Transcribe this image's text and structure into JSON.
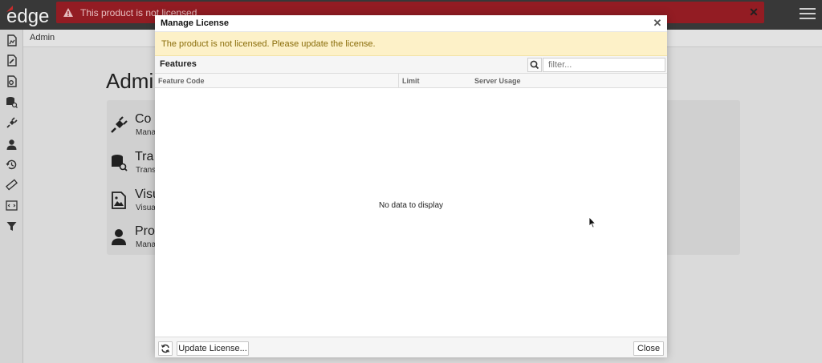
{
  "app": {
    "logo_text": "edge",
    "banner_text": "This product is not licensed",
    "breadcrumb": "Admin",
    "page_title": "Admin"
  },
  "sidebar": {
    "items": [
      {
        "icon": "report-icon"
      },
      {
        "icon": "edit-doc-icon"
      },
      {
        "icon": "doc-settings-icon"
      },
      {
        "icon": "database-search-icon"
      },
      {
        "icon": "plug-icon"
      },
      {
        "icon": "user-icon"
      },
      {
        "icon": "history-icon"
      },
      {
        "icon": "ruler-icon"
      },
      {
        "icon": "code-icon"
      },
      {
        "icon": "filter-icon"
      }
    ]
  },
  "cards": [
    {
      "title": "Co",
      "sub": "Mana",
      "icon": "plug-icon"
    },
    {
      "title": "Tra",
      "sub": "Trans",
      "icon": "database-search-icon"
    },
    {
      "title": "Visu",
      "sub": "Visua",
      "icon": "image-icon"
    },
    {
      "title": "Prov",
      "sub": "Mana",
      "icon": "user-icon"
    }
  ],
  "modal": {
    "title": "Manage License",
    "alert": "The product is not licensed. Please update the license.",
    "features_label": "Features",
    "filter_placeholder": "filter...",
    "columns": [
      "Feature Code",
      "Limit",
      "Server Usage"
    ],
    "empty_text": "No data to display",
    "update_button": "Update License...",
    "close_button": "Close"
  },
  "colors": {
    "banner": "#9b1e25",
    "alert_bg": "#fdf1c8",
    "alert_text": "#8a6d0a",
    "topbar": "#3c3c3c"
  }
}
